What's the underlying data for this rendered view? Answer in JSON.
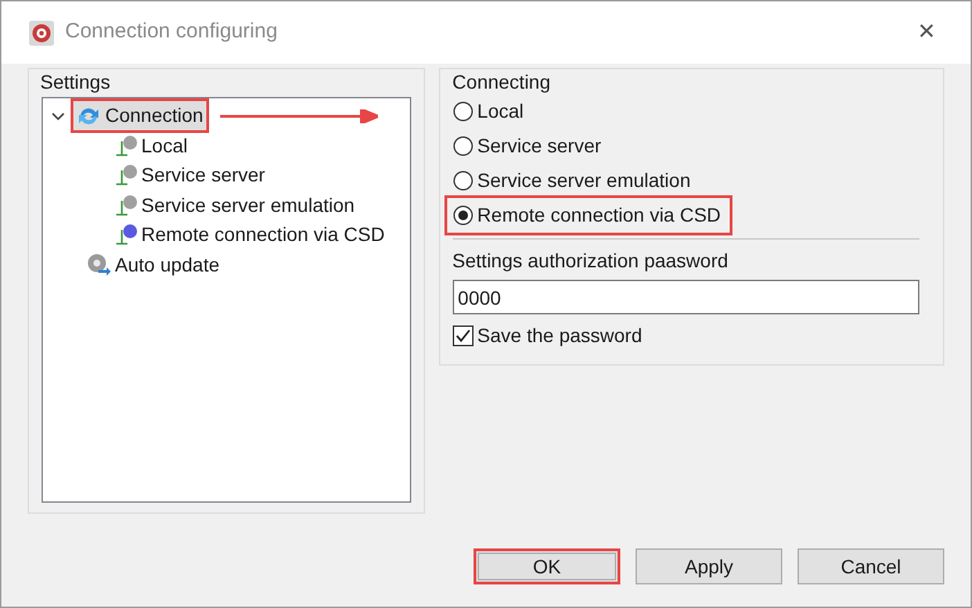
{
  "window": {
    "title": "Connection configuring",
    "close": "✕"
  },
  "settings": {
    "title": "Settings",
    "tree": [
      {
        "label": "Connection",
        "kind": "folder",
        "expanded": true,
        "selected": true,
        "highlighted": true,
        "children": [
          {
            "label": "Local",
            "kind": "node",
            "color": "#a0a0a0"
          },
          {
            "label": "Service server",
            "kind": "node",
            "color": "#a0a0a0"
          },
          {
            "label": "Service server emulation",
            "kind": "node",
            "color": "#a0a0a0"
          },
          {
            "label": "Remote connection via CSD",
            "kind": "node",
            "color": "#5a5ae0"
          }
        ]
      },
      {
        "label": "Auto update",
        "kind": "gear"
      }
    ]
  },
  "connecting": {
    "title": "Connecting",
    "options": [
      {
        "label": "Local",
        "selected": false,
        "highlighted": false
      },
      {
        "label": "Service server",
        "selected": false,
        "highlighted": false
      },
      {
        "label": "Service server emulation",
        "selected": false,
        "highlighted": false
      },
      {
        "label": "Remote connection via CSD",
        "selected": true,
        "highlighted": true
      }
    ],
    "password_label": "Settings authorization paasword",
    "password": "0000",
    "save_password": {
      "label": "Save the password",
      "checked": true
    }
  },
  "buttons": [
    {
      "label": "OK",
      "highlighted": true
    },
    {
      "label": "Apply",
      "highlighted": false
    },
    {
      "label": "Cancel",
      "highlighted": false
    }
  ]
}
